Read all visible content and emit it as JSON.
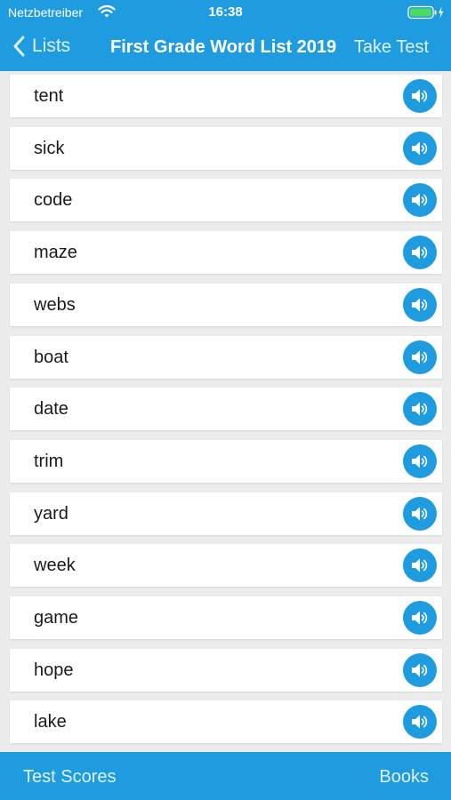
{
  "status_bar": {
    "carrier": "Netzbetreiber",
    "time": "16:38",
    "wifi_icon": "wifi-icon",
    "battery_icon": "battery-charging-icon"
  },
  "nav": {
    "back_label": "Lists",
    "back_icon": "chevron-left-icon",
    "title": "First Grade Word List 2019",
    "action_label": "Take Test"
  },
  "words": [
    {
      "text": "tent"
    },
    {
      "text": "sick"
    },
    {
      "text": "code"
    },
    {
      "text": "maze"
    },
    {
      "text": "webs"
    },
    {
      "text": "boat"
    },
    {
      "text": "date"
    },
    {
      "text": "trim"
    },
    {
      "text": "yard"
    },
    {
      "text": "week"
    },
    {
      "text": "game"
    },
    {
      "text": "hope"
    },
    {
      "text": "lake"
    }
  ],
  "row_icon": "speaker-icon",
  "toolbar": {
    "left_label": "Test Scores",
    "right_label": "Books"
  },
  "colors": {
    "accent": "#1f9cdf",
    "background": "#ececec",
    "battery": "#4cd964"
  }
}
